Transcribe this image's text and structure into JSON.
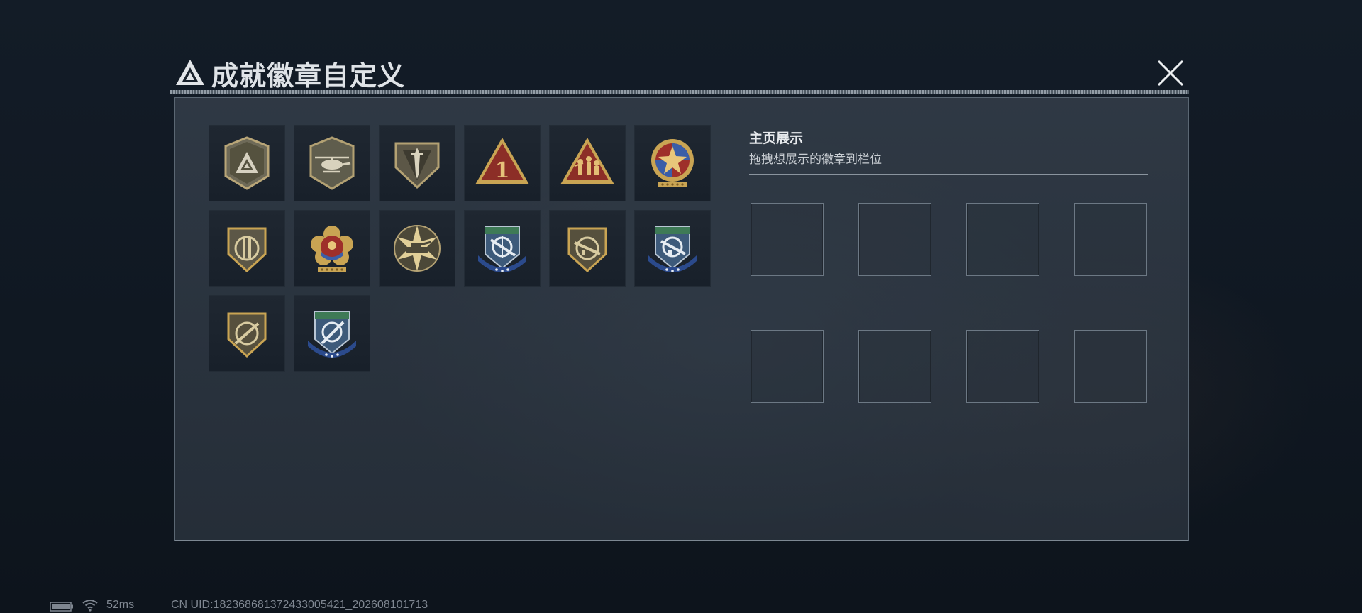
{
  "header": {
    "title": "成就徽章自定义"
  },
  "badges": [
    {
      "icon": "delta-shield-badge-icon"
    },
    {
      "icon": "helicopter-shield-badge-icon"
    },
    {
      "icon": "dagger-shield-badge-icon"
    },
    {
      "icon": "number-one-triangle-badge-icon",
      "text": "1"
    },
    {
      "icon": "soldiers-triangle-badge-icon"
    },
    {
      "icon": "star-wreath-medal-badge-icon"
    },
    {
      "icon": "bars-shield-badge-icon"
    },
    {
      "icon": "flower-medal-badge-icon"
    },
    {
      "icon": "tank-starburst-badge-icon"
    },
    {
      "icon": "blue-rifle-crest-badge-icon"
    },
    {
      "icon": "rifle-shield-badge-icon"
    },
    {
      "icon": "blue-rifle-crest-badge-icon-2"
    },
    {
      "icon": "sniper-shield-badge-icon"
    },
    {
      "icon": "blue-sniper-crest-badge-icon"
    }
  ],
  "showcase": {
    "title": "主页展示",
    "subtitle": "拖拽想展示的徽章到栏位",
    "slot_count": 8
  },
  "status_bar": {
    "ping": "52ms",
    "uid": "CN UID:18236868137243300542‌1_202608101713"
  },
  "colors": {
    "gold": "#c9a453",
    "olive": "#6f6a4e",
    "blue": "#2b4a8c",
    "green": "#3e7a56",
    "red": "#9e2f2a"
  }
}
